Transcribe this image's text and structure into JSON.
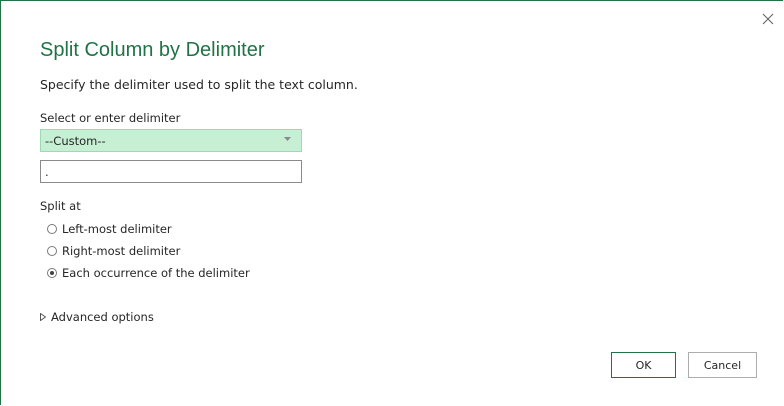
{
  "dialog": {
    "title": "Split Column by Delimiter",
    "subtitle": "Specify the delimiter used to split the text column.",
    "accent_color": "#217346",
    "select_bg_color": "#c6efd4"
  },
  "delimiter": {
    "label": "Select or enter delimiter",
    "selected": "--Custom--",
    "custom_value": "."
  },
  "split_at": {
    "label": "Split at",
    "options": [
      {
        "label": "Left-most delimiter",
        "checked": false
      },
      {
        "label": "Right-most delimiter",
        "checked": false
      },
      {
        "label": "Each occurrence of the delimiter",
        "checked": true
      }
    ]
  },
  "advanced": {
    "label": "Advanced options",
    "icon": "triangle-right-icon"
  },
  "buttons": {
    "ok": "OK",
    "cancel": "Cancel",
    "close_icon": "close-icon"
  }
}
